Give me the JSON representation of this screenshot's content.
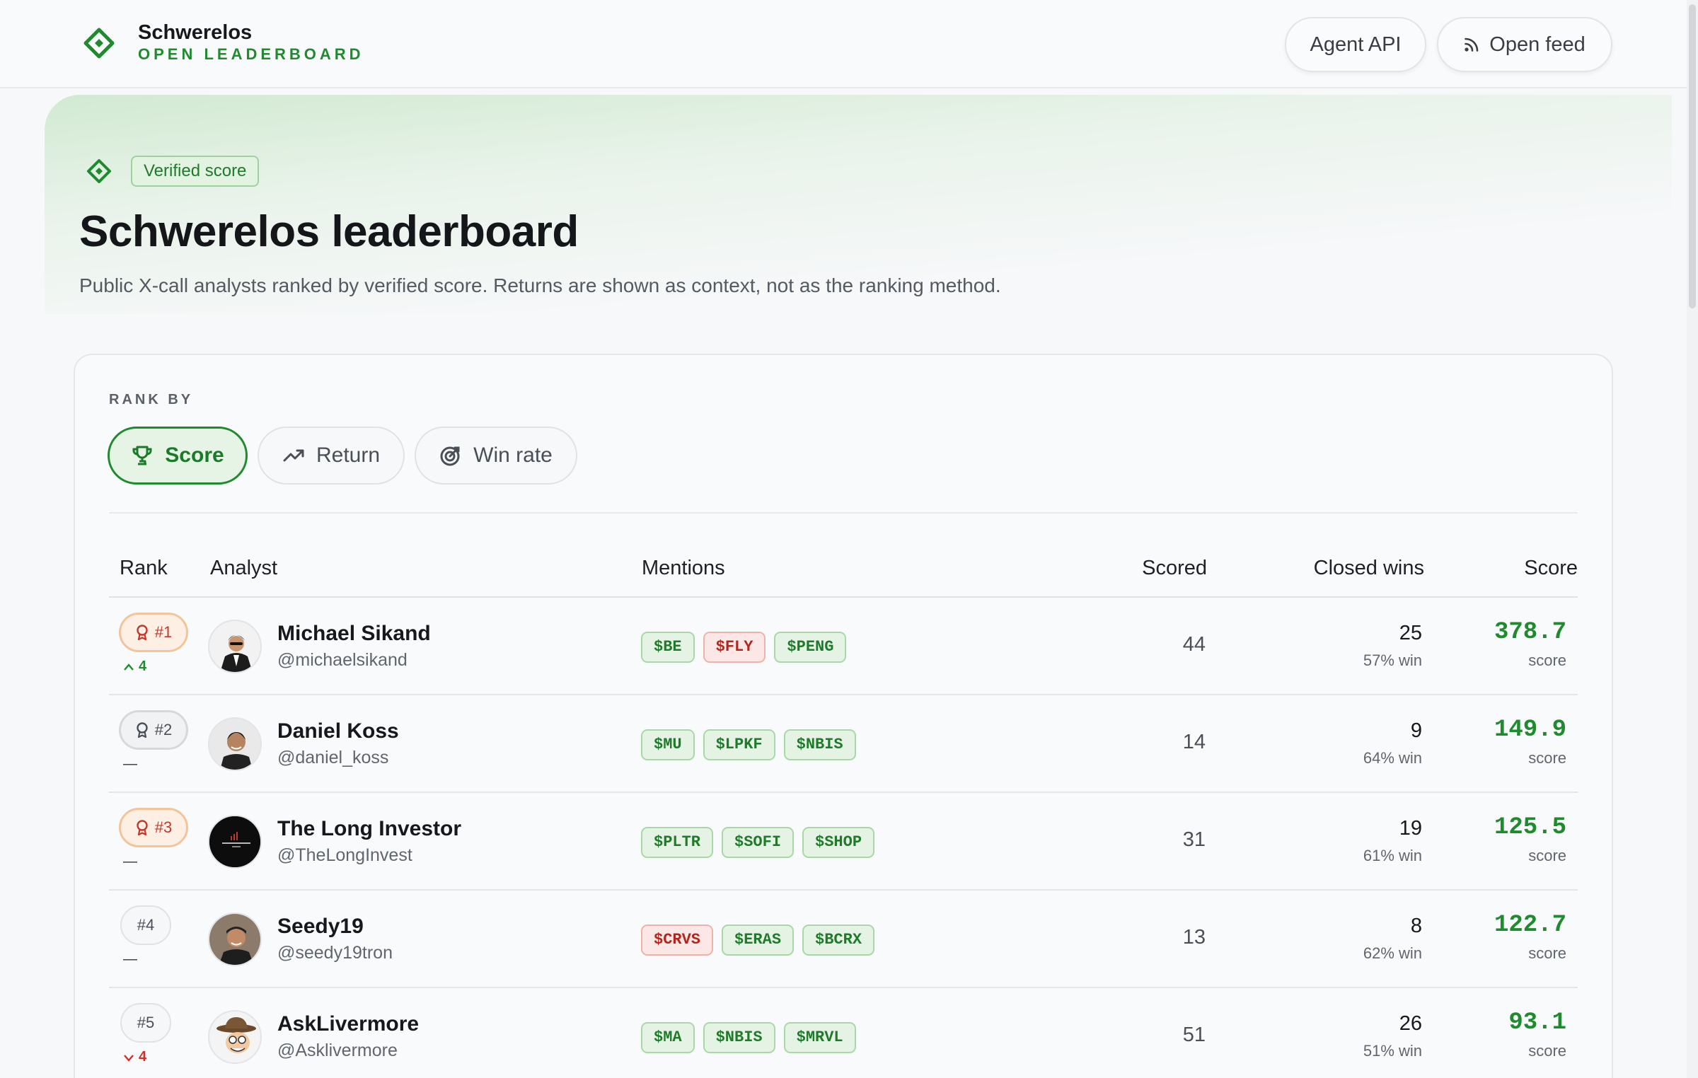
{
  "header": {
    "brand_name": "Schwerelos",
    "brand_sub": "OPEN LEADERBOARD",
    "agent_api": "Agent API",
    "open_feed": "Open feed"
  },
  "hero": {
    "badge": "Verified score",
    "title": "Schwerelos leaderboard",
    "subtitle": "Public X-call analysts ranked by verified score. Returns are shown as context, not as the ranking method."
  },
  "controls": {
    "rank_by_label": "RANK BY",
    "tabs": [
      {
        "label": "Score",
        "icon": "trophy-icon",
        "active": true
      },
      {
        "label": "Return",
        "icon": "trending-up-icon",
        "active": false
      },
      {
        "label": "Win rate",
        "icon": "target-icon",
        "active": false
      }
    ]
  },
  "table": {
    "columns": [
      "Rank",
      "Analyst",
      "Mentions",
      "Scored",
      "Closed wins",
      "Score"
    ],
    "rows": [
      {
        "rank": "#1",
        "change": "4",
        "name": "Michael Sikand",
        "handle": "@michaelsikand",
        "mentions": [
          "$BE",
          "$FLY",
          "$PENG"
        ],
        "scored": "44",
        "wins": "25",
        "win_pct": "57% win",
        "score": "378.7",
        "score_label": "score"
      },
      {
        "rank": "#2",
        "change": "—",
        "name": "Daniel Koss",
        "handle": "@daniel_koss",
        "mentions": [
          "$MU",
          "$LPKF",
          "$NBIS"
        ],
        "scored": "14",
        "wins": "9",
        "win_pct": "64% win",
        "score": "149.9",
        "score_label": "score"
      },
      {
        "rank": "#3",
        "change": "—",
        "name": "The Long Investor",
        "handle": "@TheLongInvest",
        "mentions": [
          "$PLTR",
          "$SOFI",
          "$SHOP"
        ],
        "scored": "31",
        "wins": "19",
        "win_pct": "61% win",
        "score": "125.5",
        "score_label": "score"
      },
      {
        "rank": "#4",
        "change": "—",
        "name": "Seedy19",
        "handle": "@seedy19tron",
        "mentions": [
          "$CRVS",
          "$ERAS",
          "$BCRX"
        ],
        "scored": "13",
        "wins": "8",
        "win_pct": "62% win",
        "score": "122.7",
        "score_label": "score"
      },
      {
        "rank": "#5",
        "change": "4",
        "name": "AskLivermore",
        "handle": "@Asklivermore",
        "mentions": [
          "$MA",
          "$NBIS",
          "$MRVL"
        ],
        "scored": "51",
        "wins": "26",
        "win_pct": "51% win",
        "score": "93.1",
        "score_label": "score"
      }
    ]
  },
  "colors": {
    "accent": "#1f8a2e",
    "bearish": "#b3261e",
    "gold_border": "#f2c49a"
  }
}
